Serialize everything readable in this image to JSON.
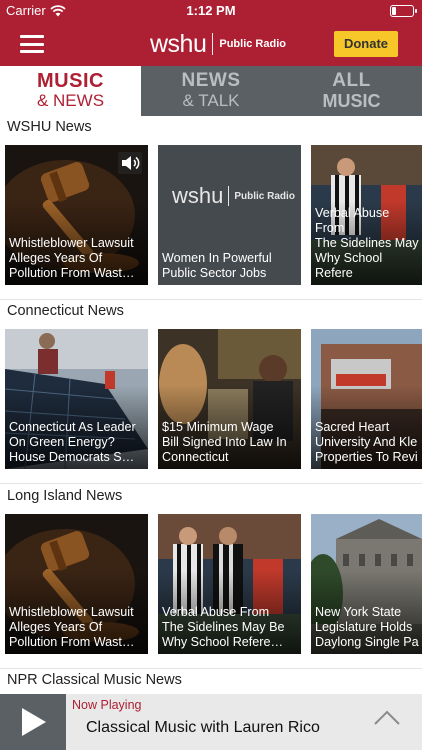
{
  "status_bar": {
    "carrier": "Carrier",
    "time": "1:12 PM",
    "battery_level": 0.2
  },
  "header": {
    "logo_word": "wshu",
    "logo_sub": "Public Radio",
    "donate_label": "Donate"
  },
  "tabs": [
    {
      "line1": "MUSIC",
      "line2": "& NEWS",
      "active": true
    },
    {
      "line1": "NEWS",
      "line2": "& TALK",
      "active": false
    },
    {
      "line1": "ALL",
      "line2": "MUSIC",
      "active": false
    }
  ],
  "sections": [
    {
      "title": "WSHU News",
      "cards": [
        {
          "title": "Whistleblower Lawsuit\nAlleges Years Of\nPollution From Wast…",
          "image": "gavel",
          "has_audio": true
        },
        {
          "title": "Women In Powerful\nPublic Sector Jobs",
          "image": "wshu-logo"
        },
        {
          "title": "Verbal Abuse From\nThe Sidelines May\nWhy School Refere",
          "image": "referees"
        }
      ]
    },
    {
      "title": "Connecticut News",
      "cards": [
        {
          "title": "Connecticut As Leader\nOn Green Energy?\nHouse Democrats S…",
          "image": "solar-panels"
        },
        {
          "title": "$15 Minimum Wage\nBill Signed Into Law In\nConnecticut",
          "image": "restaurant"
        },
        {
          "title": "Sacred Heart\nUniversity And Kle\nProperties To Revi",
          "image": "theater"
        }
      ]
    },
    {
      "title": "Long Island News",
      "cards": [
        {
          "title": "Whistleblower Lawsuit\nAlleges Years Of\nPollution From Wast…",
          "image": "gavel"
        },
        {
          "title": "Verbal Abuse From\nThe Sidelines May Be\nWhy School Refere…",
          "image": "referees"
        },
        {
          "title": "New York State\nLegislature Holds\nDaylong Single Pa",
          "image": "capitol"
        }
      ]
    },
    {
      "title": "NPR Classical Music News",
      "cards": []
    }
  ],
  "player": {
    "now_playing_label": "Now Playing",
    "program": "Classical Music with Lauren Rico"
  },
  "colors": {
    "brand": "#ad1f33",
    "donate": "#f7c729",
    "tab_bar": "#5a6064"
  }
}
